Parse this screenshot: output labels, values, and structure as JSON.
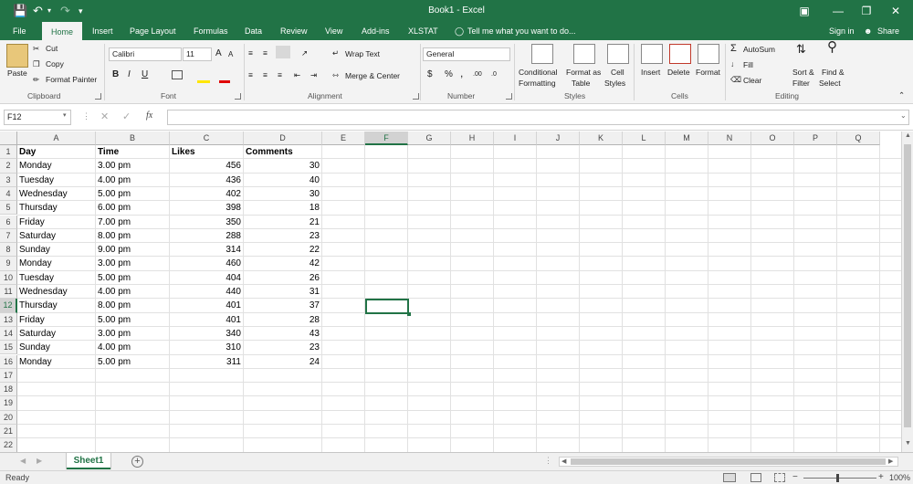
{
  "title": "Book1 - Excel",
  "colors": {
    "accent": "#217346"
  },
  "tabs": [
    "File",
    "Home",
    "Insert",
    "Page Layout",
    "Formulas",
    "Data",
    "Review",
    "View",
    "Add-ins",
    "XLSTAT"
  ],
  "tell_me": "Tell me what you want to do...",
  "signin": "Sign in",
  "share": "Share",
  "clipboard": {
    "paste": "Paste",
    "cut": "Cut",
    "copy": "Copy",
    "format_painter": "Format Painter",
    "label": "Clipboard"
  },
  "font": {
    "name": "Calibri",
    "size": "11",
    "label": "Font",
    "bold": "B",
    "italic": "I",
    "underline": "U"
  },
  "alignment": {
    "wrap": "Wrap Text",
    "merge": "Merge & Center",
    "label": "Alignment"
  },
  "number": {
    "format": "General",
    "label": "Number",
    "currency": "$",
    "percent": "%",
    "comma": ","
  },
  "styles": {
    "conditional1": "Conditional",
    "conditional2": "Formatting",
    "table1": "Format as",
    "table2": "Table",
    "cell1": "Cell",
    "cell2": "Styles",
    "label": "Styles"
  },
  "cells": {
    "insert": "Insert",
    "delete": "Delete",
    "format": "Format",
    "label": "Cells"
  },
  "editing": {
    "autosum": "AutoSum",
    "fill": "Fill",
    "clear": "Clear",
    "sort1": "Sort &",
    "sort2": "Filter",
    "find1": "Find &",
    "find2": "Select",
    "label": "Editing"
  },
  "namebox": "F12",
  "fx": "fx",
  "columns": [
    "A",
    "B",
    "C",
    "D",
    "E",
    "F",
    "G",
    "H",
    "I",
    "J",
    "K",
    "L",
    "M",
    "N",
    "O",
    "P",
    "Q"
  ],
  "rows": [
    "1",
    "2",
    "3",
    "4",
    "5",
    "6",
    "7",
    "8",
    "9",
    "10",
    "11",
    "12",
    "13",
    "14",
    "15",
    "16",
    "17",
    "18",
    "19",
    "20",
    "21",
    "22"
  ],
  "headers": [
    "Day",
    "Time",
    "Likes",
    "Comments"
  ],
  "data": [
    [
      "Monday",
      "3.00 pm",
      "456",
      "30"
    ],
    [
      "Tuesday",
      "4.00 pm",
      "436",
      "40"
    ],
    [
      "Wednesday",
      "5.00 pm",
      "402",
      "30"
    ],
    [
      "Thursday",
      "6.00 pm",
      "398",
      "18"
    ],
    [
      "Friday",
      "7.00 pm",
      "350",
      "21"
    ],
    [
      "Saturday",
      "8.00 pm",
      "288",
      "23"
    ],
    [
      "Sunday",
      "9.00 pm",
      "314",
      "22"
    ],
    [
      "Monday",
      "3.00 pm",
      "460",
      "42"
    ],
    [
      "Tuesday",
      "5.00 pm",
      "404",
      "26"
    ],
    [
      "Wednesday",
      "4.00 pm",
      "440",
      "31"
    ],
    [
      "Thursday",
      "8.00 pm",
      "401",
      "37"
    ],
    [
      "Friday",
      "5.00 pm",
      "401",
      "28"
    ],
    [
      "Saturday",
      "3.00 pm",
      "340",
      "43"
    ],
    [
      "Sunday",
      "4.00 pm",
      "310",
      "23"
    ],
    [
      "Monday",
      "5.00 pm",
      "311",
      "24"
    ]
  ],
  "sheet": "Sheet1",
  "status": "Ready",
  "zoom": "100%"
}
